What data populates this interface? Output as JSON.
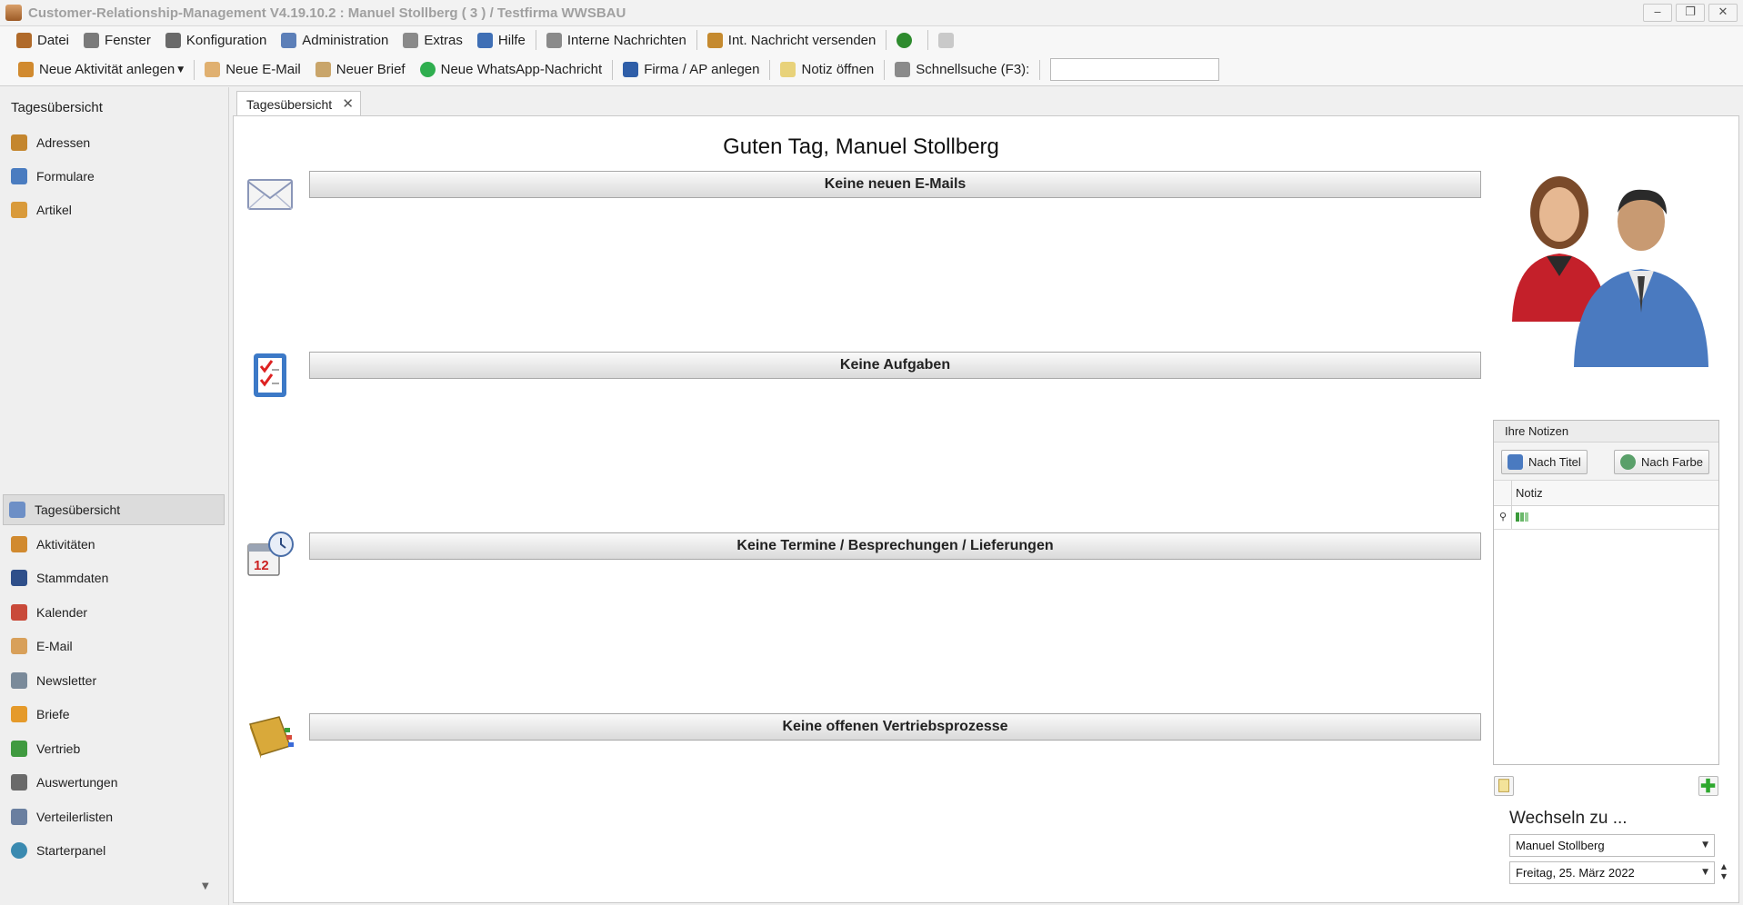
{
  "window": {
    "title": "Customer-Relationship-Management V4.19.10.2 : Manuel Stollberg ( 3 ) / Testfirma WWSBAU",
    "minimize": "‒",
    "restore": "❐",
    "close": "✕"
  },
  "menubar": [
    {
      "label": "Datei",
      "icon": "datei-icon",
      "color": "#b06a2a"
    },
    {
      "label": "Fenster",
      "icon": "window-grid-icon",
      "color": "#7a7a7a"
    },
    {
      "label": "Konfiguration",
      "icon": "tools-icon",
      "color": "#6a6a6a"
    },
    {
      "label": "Administration",
      "icon": "admin-icon",
      "color": "#5c7fb8"
    },
    {
      "label": "Extras",
      "icon": "calculator-icon",
      "color": "#8a8a8a"
    },
    {
      "label": "Hilfe",
      "icon": "help-icon",
      "color": "#3f6fb5"
    },
    {
      "label": "Interne Nachrichten",
      "icon": "pin-icon",
      "color": "#8a8a8a"
    },
    {
      "label": "Int. Nachricht versenden",
      "icon": "send-message-icon",
      "color": "#c58a2f"
    }
  ],
  "menubar_extra": {
    "user_icon_color": "#2e8b2e"
  },
  "toolbar": {
    "new_activity": "Neue Aktivität anlegen",
    "new_email": "Neue E-Mail",
    "new_letter": "Neuer Brief",
    "new_whatsapp": "Neue WhatsApp-Nachricht",
    "new_company": "Firma / AP anlegen",
    "open_note": "Notiz öffnen",
    "quick_search": "Schnellsuche (F3):",
    "quick_search_value": ""
  },
  "sidebar": {
    "header": "Tagesübersicht",
    "top_items": [
      {
        "label": "Adressen",
        "color": "#c4862e"
      },
      {
        "label": "Formulare",
        "color": "#4a7cc0"
      },
      {
        "label": "Artikel",
        "color": "#d99a3a"
      }
    ],
    "bottom_items": [
      {
        "label": "Tagesübersicht",
        "color": "#6d8fc6",
        "active": true
      },
      {
        "label": "Aktivitäten",
        "color": "#d18a2f"
      },
      {
        "label": "Stammdaten",
        "color": "#2f4f8a"
      },
      {
        "label": "Kalender",
        "color": "#c94a3a"
      },
      {
        "label": "E-Mail",
        "color": "#d8a05a"
      },
      {
        "label": "Newsletter",
        "color": "#7a8a9a"
      },
      {
        "label": "Briefe",
        "color": "#e59a2a"
      },
      {
        "label": "Vertrieb",
        "color": "#3f9a3f"
      },
      {
        "label": "Auswertungen",
        "color": "#6a6a6a"
      },
      {
        "label": "Verteilerlisten",
        "color": "#6a7fa0"
      },
      {
        "label": "Starterpanel",
        "color": "#3a8ab0"
      }
    ]
  },
  "tab": {
    "label": "Tagesübersicht",
    "close": "✕"
  },
  "main": {
    "greeting": "Guten Tag, Manuel Stollberg",
    "sections": [
      {
        "label": "Keine neuen E-Mails",
        "icon": "envelope-icon"
      },
      {
        "label": "Keine Aufgaben",
        "icon": "checklist-icon"
      },
      {
        "label": "Keine Termine / Besprechungen / Lieferungen",
        "icon": "calendar-clock-icon"
      },
      {
        "label": "Keine offenen Vertriebsprozesse",
        "icon": "book-icon"
      }
    ]
  },
  "notes": {
    "header": "Ihre Notizen",
    "sort_title": "Nach Titel",
    "sort_color": "Nach Farbe",
    "column": "Notiz"
  },
  "switch": {
    "label": "Wechseln zu ...",
    "user": "Manuel Stollberg",
    "date": "Freitag, 25. März 2022"
  }
}
